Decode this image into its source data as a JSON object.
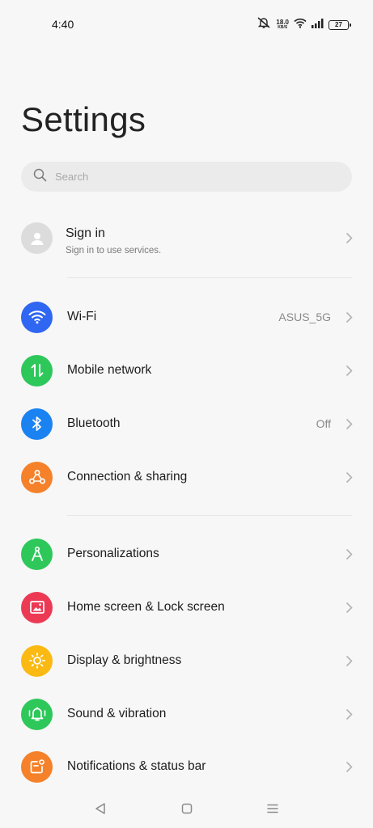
{
  "status_bar": {
    "time": "4:40",
    "speed_value": "18.0",
    "speed_unit": "KB/S",
    "battery": "27"
  },
  "header": {
    "title": "Settings"
  },
  "search": {
    "placeholder": "Search"
  },
  "account": {
    "title": "Sign in",
    "subtitle": "Sign in to use services."
  },
  "settings_groups": [
    [
      {
        "label": "Wi-Fi",
        "value": "ASUS_5G",
        "icon": "wifi-icon",
        "color": "#2f66f2"
      },
      {
        "label": "Mobile network",
        "value": "",
        "icon": "mobile-data-icon",
        "color": "#2ec85a"
      },
      {
        "label": "Bluetooth",
        "value": "Off",
        "icon": "bluetooth-icon",
        "color": "#1b82f2"
      },
      {
        "label": "Connection & sharing",
        "value": "",
        "icon": "connection-sharing-icon",
        "color": "#f5812a"
      }
    ],
    [
      {
        "label": "Personalizations",
        "value": "",
        "icon": "compass-icon",
        "color": "#2ec85a"
      },
      {
        "label": "Home screen & Lock screen",
        "value": "",
        "icon": "picture-icon",
        "color": "#ec3a55"
      },
      {
        "label": "Display & brightness",
        "value": "",
        "icon": "sun-icon",
        "color": "#fbb913"
      },
      {
        "label": "Sound & vibration",
        "value": "",
        "icon": "bell-vibration-icon",
        "color": "#2ec85a"
      },
      {
        "label": "Notifications & status bar",
        "value": "",
        "icon": "notification-icon",
        "color": "#f5812a"
      }
    ]
  ]
}
